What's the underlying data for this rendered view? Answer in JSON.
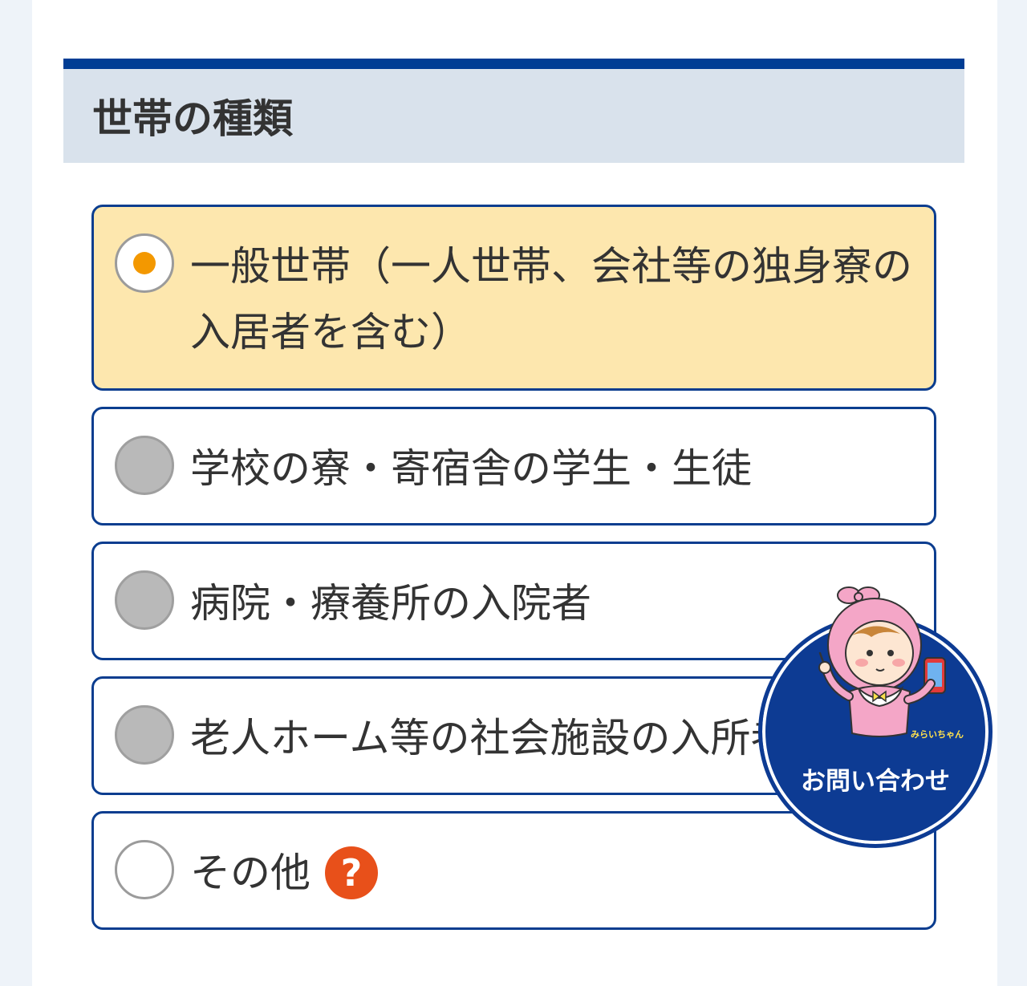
{
  "section": {
    "title": "世帯の種類"
  },
  "options": [
    {
      "label": "一般世帯（一人世帯、会社等の独身寮の入居者を含む）",
      "state": "selected"
    },
    {
      "label": "学校の寮・寄宿舎の学生・生徒",
      "state": "disabled"
    },
    {
      "label": "病院・療養所の入院者",
      "state": "disabled"
    },
    {
      "label": "老人ホーム等の社会施設の入所者",
      "state": "disabled"
    },
    {
      "label": "その他",
      "state": "unselected",
      "help_icon": "?"
    }
  ],
  "contact_button": {
    "label": "お問い合わせ",
    "mascot_name": "みらいちゃん"
  },
  "colors": {
    "header_accent": "#003d94",
    "selected_bg": "#fde7ae",
    "radio_dot": "#f39800",
    "help_icon": "#e8501a",
    "contact_bg": "#0d3b93"
  },
  "icons": {
    "help": "question-circle-icon",
    "mascot": "mirai-chan-mascot"
  }
}
